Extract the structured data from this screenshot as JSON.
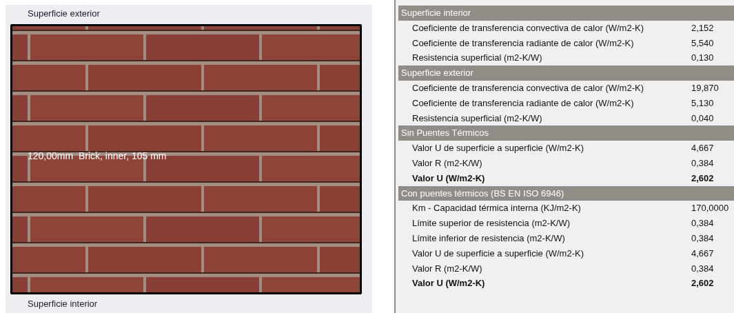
{
  "wall_view": {
    "top_label": "Superficie exterior",
    "layer_label": "120,00mm  Brick, inner, 105 mm",
    "bottom_label": "Superficie interior"
  },
  "results": [
    {
      "title": "Superficie interior",
      "rows": [
        {
          "label": "Coeficiente de transferencia convectiva de calor (W/m2-K)",
          "value": "2,152",
          "bold": false
        },
        {
          "label": "Coeficiente de transferencia radiante de calor (W/m2-K)",
          "value": "5,540",
          "bold": false
        },
        {
          "label": "Resistencia superficial (m2-K/W)",
          "value": "0,130",
          "bold": false
        }
      ]
    },
    {
      "title": "Superficie exterior",
      "rows": [
        {
          "label": "Coeficiente de transferencia convectiva de calor (W/m2-K)",
          "value": "19,870",
          "bold": false
        },
        {
          "label": "Coeficiente de transferencia radiante de calor (W/m2-K)",
          "value": "5,130",
          "bold": false
        },
        {
          "label": "Resistencia superficial (m2-K/W)",
          "value": "0,040",
          "bold": false
        }
      ]
    },
    {
      "title": "Sin Puentes Térmicos",
      "rows": [
        {
          "label": "Valor U de superficie a superficie (W/m2-K)",
          "value": "4,667",
          "bold": false
        },
        {
          "label": "Valor R (m2-K/W)",
          "value": "0,384",
          "bold": false
        },
        {
          "label": "Valor U (W/m2-K)",
          "value": "2,602",
          "bold": true
        }
      ]
    },
    {
      "title": "Con puentes térmicos (BS EN ISO 6946)",
      "rows": [
        {
          "label": "Km - Capacidad térmica interna (KJ/m2-K)",
          "value": "170,0000",
          "bold": false
        },
        {
          "label": "Límite superior de resistencia (m2-K/W)",
          "value": "0,384",
          "bold": false
        },
        {
          "label": "Límite inferior de resistencia (m2-K/W)",
          "value": "0,384",
          "bold": false
        },
        {
          "label": "Valor U de superficie a superficie (W/m2-K)",
          "value": "4,667",
          "bold": false
        },
        {
          "label": "Valor R (m2-K/W)",
          "value": "0,384",
          "bold": false
        },
        {
          "label": "Valor U (W/m2-K)",
          "value": "2,602",
          "bold": true
        }
      ]
    }
  ]
}
